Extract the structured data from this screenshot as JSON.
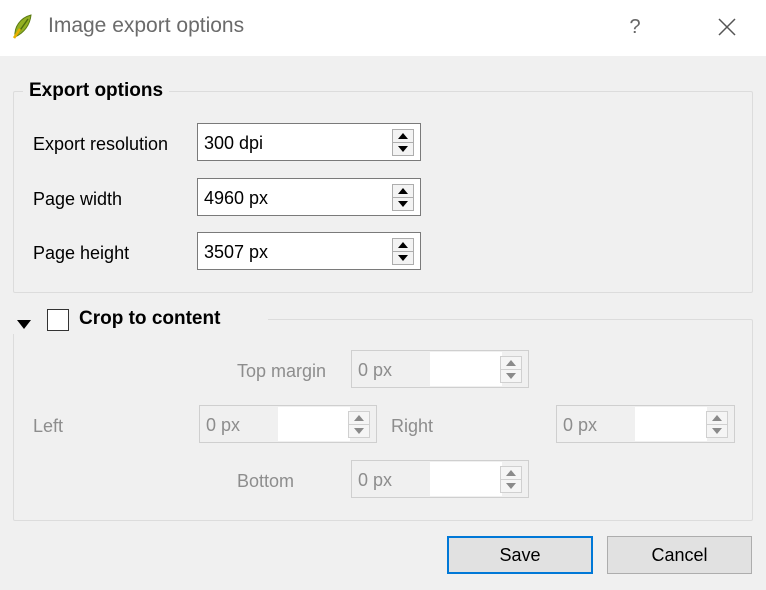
{
  "window": {
    "title": "Image export options",
    "help_label": "?",
    "icons": {
      "app": "qgis-leaf-icon",
      "help": "help-icon",
      "close": "close-icon"
    }
  },
  "export_options": {
    "group_title": "Export options",
    "resolution": {
      "label": "Export resolution",
      "value": "300 dpi"
    },
    "page_width": {
      "label": "Page width",
      "value": "4960 px"
    },
    "page_height": {
      "label": "Page height",
      "value": "3507 px"
    }
  },
  "crop": {
    "group_title": "Crop to content",
    "checked": false,
    "top": {
      "label": "Top margin",
      "value": "0 px"
    },
    "left": {
      "label": "Left",
      "value": "0 px"
    },
    "right": {
      "label": "Right",
      "value": "0 px"
    },
    "bottom": {
      "label": "Bottom",
      "value": "0 px"
    }
  },
  "buttons": {
    "save": "Save",
    "cancel": "Cancel"
  },
  "colors": {
    "accent": "#0078d7",
    "background": "#f0f0f0",
    "disabled_text": "#8d8d8d"
  }
}
